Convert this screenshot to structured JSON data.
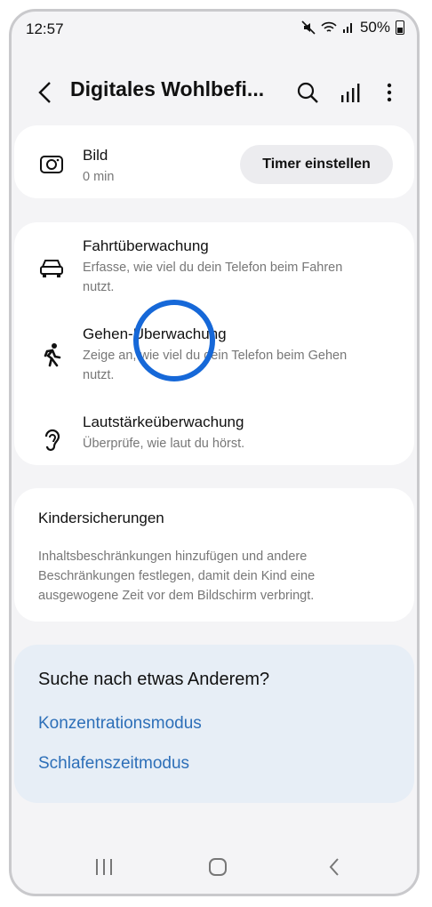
{
  "status": {
    "time": "12:57",
    "battery": "50%"
  },
  "appbar": {
    "title": "Digitales Wohlbefi..."
  },
  "media_card": {
    "title": "Bild",
    "subtitle": "0 min",
    "button_label": "Timer einstellen"
  },
  "monitors": [
    {
      "title": "Fahrtüberwachung",
      "line1": "Erfasse, wie viel du dein Telefon beim Fahren",
      "line2": "nutzt."
    },
    {
      "title": "Gehen-Überwachung",
      "line1": "Zeige an, wie viel du dein Telefon beim Gehen",
      "line2": "nutzt."
    },
    {
      "title": "Lautstärkeüberwachung",
      "line1": "Überprüfe, wie laut du hörst."
    }
  ],
  "parental": {
    "title": "Kindersicherungen",
    "line1": "Inhaltsbeschränkungen hinzufügen und andere",
    "line2": "Beschränkungen festlegen, damit dein Kind eine",
    "line3": "ausgewogene Zeit vor dem Bildschirm verbringt."
  },
  "suggestions": {
    "title": "Suche nach etwas Anderem?",
    "links": [
      "Konzentrationsmodus",
      "Schlafenszeitmodus"
    ]
  },
  "colors": {
    "link": "#2d6fb8",
    "highlight_circle": "#1668d8"
  }
}
